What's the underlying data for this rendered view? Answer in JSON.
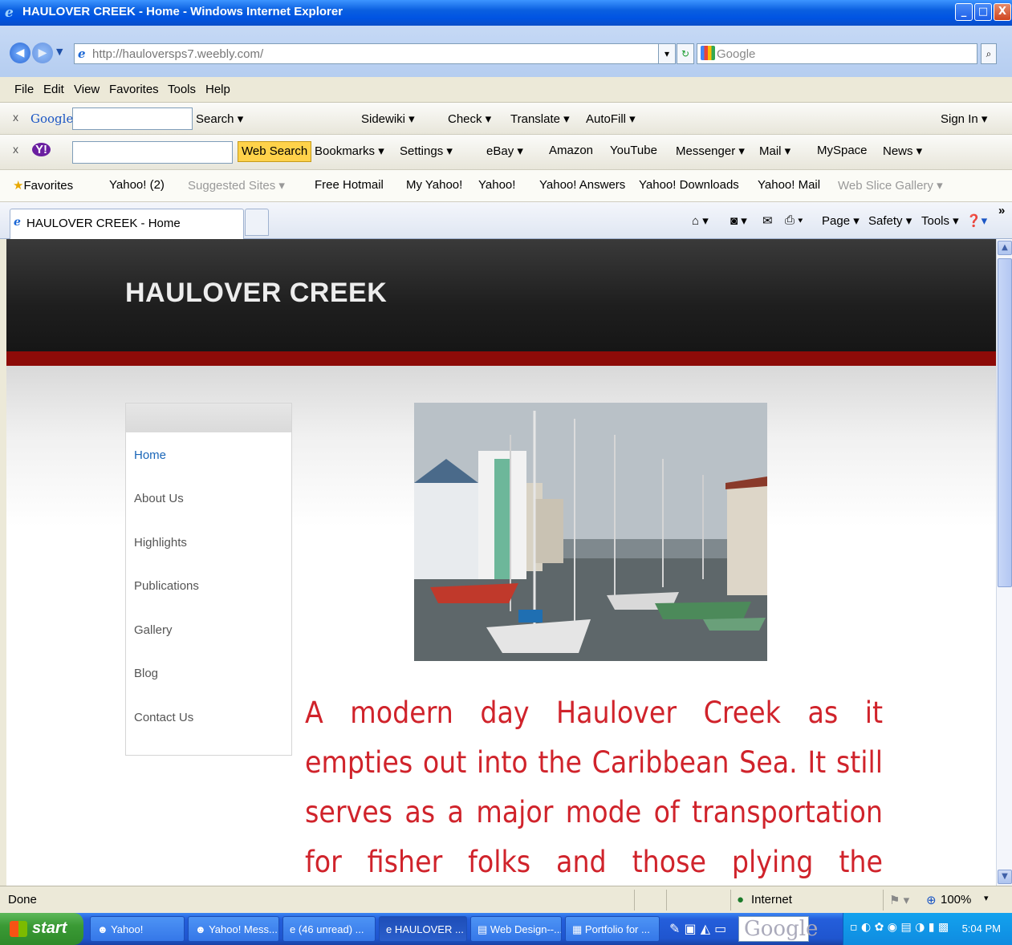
{
  "window": {
    "title": "HAULOVER  CREEK - Home - Windows Internet Explorer",
    "min": "_",
    "max": "□",
    "close": "X"
  },
  "address": {
    "url": "http://hauloversps7.weebly.com/",
    "search_placeholder": "Google"
  },
  "menu": [
    "File",
    "Edit",
    "View",
    "Favorites",
    "Tools",
    "Help"
  ],
  "google_toolbar": {
    "brand": "Google",
    "items": [
      "Search ▾",
      "Sidewiki ▾",
      "Check ▾",
      "Translate ▾",
      "AutoFill ▾"
    ],
    "sign_in": "Sign In ▾"
  },
  "yahoo_toolbar": {
    "brand": "Y!",
    "web_search": "Web Search",
    "items": [
      "Bookmarks ▾",
      "Settings ▾",
      "eBay ▾",
      "Amazon",
      "YouTube",
      "Messenger ▾",
      "Mail ▾",
      "MySpace",
      "News ▾"
    ]
  },
  "favorites_bar": {
    "favorites_label": "Favorites",
    "items": [
      "Yahoo! (2)",
      "Suggested Sites ▾",
      "Free Hotmail",
      "My Yahoo!",
      "Yahoo!",
      "Yahoo! Answers",
      "Yahoo! Downloads",
      "Yahoo! Mail",
      "Web Slice Gallery ▾"
    ]
  },
  "tab": {
    "label": "HAULOVER  CREEK - Home",
    "commands": [
      "Page ▾",
      "Safety ▾",
      "Tools ▾"
    ]
  },
  "site": {
    "title": "HAULOVER  CREEK",
    "nav": [
      "Home",
      "About Us",
      "Highlights",
      "Publications",
      "Gallery",
      "Blog",
      "Contact Us"
    ],
    "active_nav": "Home",
    "caption": " A modern day Haulover Creek as it empties out into the Caribbean Sea.  It still serves as a major mode of transportation for fisher folks and those plying the tourism trade by"
  },
  "status": {
    "text": "Done",
    "zone": "Internet",
    "zoom": "100%"
  },
  "taskbar": {
    "start": "start",
    "items": [
      "Yahoo!",
      "Yahoo! Mess...",
      "(46 unread) ...",
      "HAULOVER ...",
      "Web Design--...",
      "Portfolio for ..."
    ],
    "active_index": 3,
    "search_brand": "Google",
    "clock": "5:04 PM"
  },
  "colors": {
    "accent_red": "#8d0b08",
    "caption_red": "#d0232b",
    "nav_active": "#1a66b8",
    "xp_blue": "#0054e3"
  }
}
